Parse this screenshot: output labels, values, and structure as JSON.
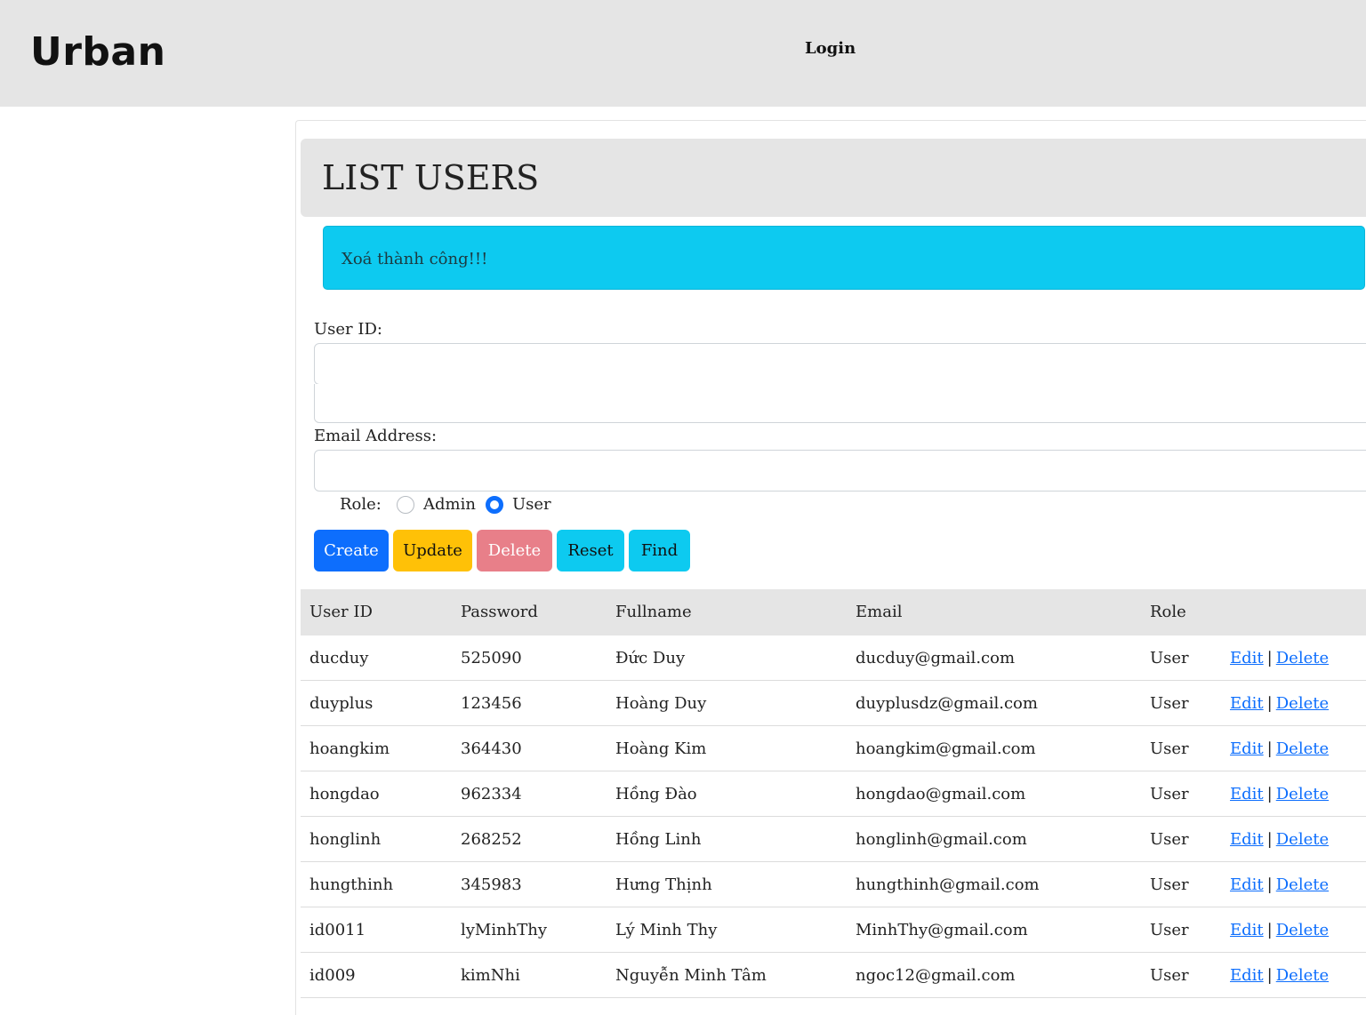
{
  "header": {
    "brand": "Urban",
    "nav_login": "Login"
  },
  "page": {
    "title": "LIST USERS",
    "alert": "Xoá thành công!!!"
  },
  "form": {
    "user_id_label": "User ID:",
    "user_id_value": "",
    "email_label": "Email Address:",
    "email_value": "",
    "role_label": "Role:",
    "role_options": [
      "Admin",
      "User"
    ],
    "role_selected": "User"
  },
  "buttons": {
    "create": "Create",
    "update": "Update",
    "delete": "Delete",
    "reset": "Reset",
    "find": "Find"
  },
  "table": {
    "headers": [
      "User ID",
      "Password",
      "Fullname",
      "Email",
      "Role",
      ""
    ],
    "edit_label": "Edit",
    "delete_label": "Delete",
    "separator": "|",
    "rows": [
      {
        "id": "ducduy",
        "password": "525090",
        "fullname": "Đức Duy",
        "email": "ducduy@gmail.com",
        "role": "User"
      },
      {
        "id": "duyplus",
        "password": "123456",
        "fullname": "Hoàng Duy",
        "email": "duyplusdz@gmail.com",
        "role": "User"
      },
      {
        "id": "hoangkim",
        "password": "364430",
        "fullname": "Hoàng Kim",
        "email": "hoangkim@gmail.com",
        "role": "User"
      },
      {
        "id": "hongdao",
        "password": "962334",
        "fullname": "Hồng Đào",
        "email": "hongdao@gmail.com",
        "role": "User"
      },
      {
        "id": "honglinh",
        "password": "268252",
        "fullname": "Hồng Linh",
        "email": "honglinh@gmail.com",
        "role": "User"
      },
      {
        "id": "hungthinh",
        "password": "345983",
        "fullname": "Hưng Thịnh",
        "email": "hungthinh@gmail.com",
        "role": "User"
      },
      {
        "id": "id0011",
        "password": "lyMinhThy",
        "fullname": "Lý Minh Thy",
        "email": "MinhThy@gmail.com",
        "role": "User"
      },
      {
        "id": "id009",
        "password": "kimNhi",
        "fullname": "Nguyễn Minh Tâm",
        "email": "ngoc12@gmail.com",
        "role": "User"
      }
    ]
  }
}
